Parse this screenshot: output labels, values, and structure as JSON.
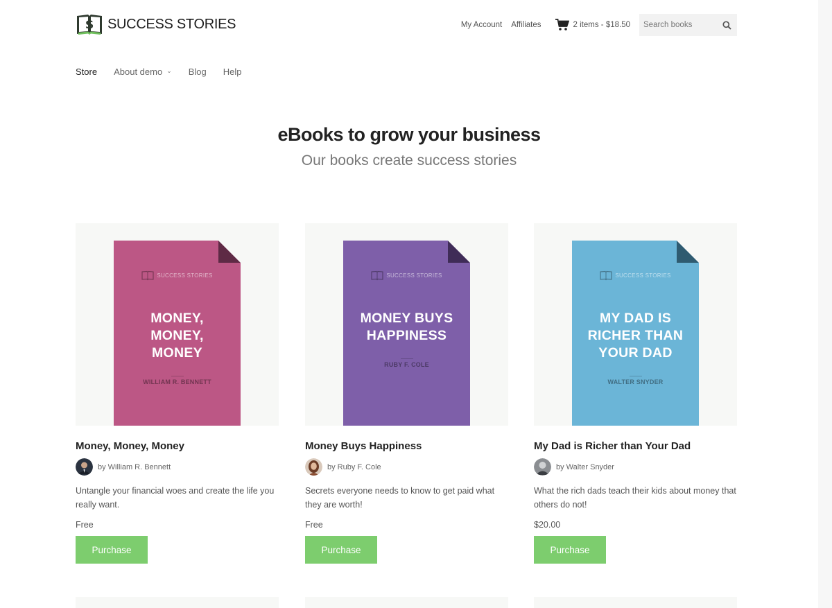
{
  "brand": {
    "name": "SUCCESS STORIES",
    "logo_icon": "dollar-book-icon"
  },
  "topnav": {
    "my_account": "My Account",
    "affiliates": "Affiliates",
    "cart_label": "2 items - $18.50",
    "search_placeholder": "Search books"
  },
  "mainnav": {
    "items": [
      {
        "label": "Store"
      },
      {
        "label": "About demo"
      },
      {
        "label": "Blog"
      },
      {
        "label": "Help"
      }
    ]
  },
  "hero": {
    "title": "eBooks to grow your business",
    "subtitle": "Our books create success stories"
  },
  "colors": {
    "accent_button": "#7dcd6e",
    "cover_pink": "#bc5785",
    "cover_purple": "#7e5fa9",
    "cover_blue": "#6bb5d7"
  },
  "products": [
    {
      "cover_brand": "SUCCESS STORIES",
      "cover_title_lines": [
        "MONEY,",
        "MONEY,",
        "MONEY"
      ],
      "cover_author": "WILLIAM R. BENNETT",
      "title": "Money, Money, Money",
      "byline": "by William R. Bennett",
      "description": "Untangle your financial woes and create the life you really want.",
      "price": "Free",
      "button": "Purchase"
    },
    {
      "cover_brand": "SUCCESS STORIES",
      "cover_title_lines": [
        "MONEY BUYS",
        "HAPPINESS"
      ],
      "cover_author": "RUBY F. COLE",
      "title": "Money Buys Happiness",
      "byline": "by Ruby F. Cole",
      "description": "Secrets everyone needs to know to get paid what they are worth!",
      "price": "Free",
      "button": "Purchase"
    },
    {
      "cover_brand": "SUCCESS STORIES",
      "cover_title_lines": [
        "MY DAD IS",
        "RICHER THAN",
        "YOUR DAD"
      ],
      "cover_author": "WALTER SNYDER",
      "title": "My Dad is Richer than Your Dad",
      "byline": "by Walter Snyder",
      "description": "What the rich dads teach their kids about money that others do not!",
      "price": "$20.00",
      "button": "Purchase"
    }
  ]
}
